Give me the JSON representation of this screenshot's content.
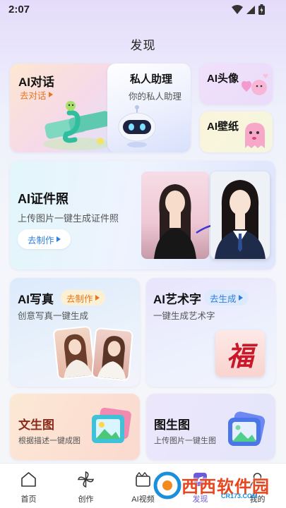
{
  "status": {
    "time": "2:07"
  },
  "header": {
    "title": "发现"
  },
  "cards": {
    "ai_chat": {
      "title": "AI对话",
      "action": "去对话"
    },
    "assistant": {
      "title": "私人助理",
      "subtitle": "你的私人助理"
    },
    "ai_avatar": {
      "title": "AI头像"
    },
    "ai_wallpaper": {
      "title": "AI壁纸"
    },
    "id_photo": {
      "title": "AI证件照",
      "subtitle": "上传图片一键生成证件照",
      "action": "去制作"
    },
    "ai_portrait": {
      "title": "AI写真",
      "action": "去制作",
      "subtitle": "创意写真一键生成"
    },
    "art_text": {
      "title": "AI艺术字",
      "action": "去生成",
      "subtitle": "一键生成艺术字",
      "sample_char": "福"
    },
    "text_to_image": {
      "title": "文生图",
      "subtitle": "根据描述一键成图"
    },
    "image_to_image": {
      "title": "图生图",
      "subtitle": "上传图片一键生图"
    }
  },
  "tabs": [
    {
      "label": "首页",
      "icon": "home-icon"
    },
    {
      "label": "创作",
      "icon": "pinwheel-icon"
    },
    {
      "label": "AI视频",
      "icon": "video-icon"
    },
    {
      "label": "发现",
      "icon": "discover-icon"
    },
    {
      "label": "我的",
      "icon": "profile-icon"
    }
  ],
  "watermark": {
    "text": "西西软件园",
    "sub": "CR173.COM"
  },
  "colors": {
    "accent_orange": "#e8761c",
    "accent_blue": "#2f7fdc",
    "accent_purple": "#6a5bd6"
  }
}
